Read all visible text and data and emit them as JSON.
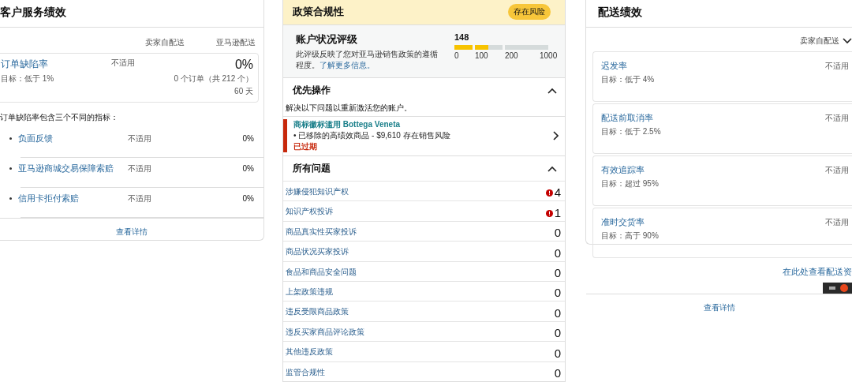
{
  "customer_service": {
    "title": "客户服务绩效",
    "columns": [
      "卖家自配送",
      "亚马逊配送"
    ],
    "metric": {
      "name": "订单缺陷率",
      "target": "目标：低于 1%",
      "mfn": "不适用",
      "afn": "0%",
      "orders": "0 个订单（共 212 个）",
      "period": "60 天"
    },
    "intro": "订单缺陷率包含三个不同的指标：",
    "sub_metrics": [
      {
        "name": "负面反馈",
        "mfn": "不适用",
        "afn": "0%"
      },
      {
        "name": "亚马逊商城交易保障索赔",
        "mfn": "不适用",
        "afn": "0%"
      },
      {
        "name": "信用卡拒付索赔",
        "mfn": "不适用",
        "afn": "0%"
      }
    ],
    "details_link": "查看详情"
  },
  "policy": {
    "title": "政策合规性",
    "badge": "存在风险",
    "rating": {
      "title": "账户状况评级",
      "description": "此评级反映了您对亚马逊销售政策的遵循程度。",
      "link": "了解更多信息。",
      "score": "148",
      "segments": [
        {
          "level": 1
        },
        {
          "level": 0.48
        },
        {
          "level": 0
        }
      ],
      "ticks": [
        "0",
        "100",
        "200",
        "1000"
      ]
    },
    "priority": {
      "title": "优先操作",
      "expanded": true,
      "hint": "解决以下问题以重新激活您的账户。",
      "items": [
        {
          "title": "商标徽标滥用 Bottega Veneta",
          "detail": "• 已移除的高绩效商品 - $9,610 存在销售风险",
          "status": "已过期"
        }
      ]
    },
    "issues": {
      "title": "所有问题",
      "expanded": true,
      "rows": [
        {
          "name": "涉嫌侵犯知识产权",
          "count": "4",
          "alert": true
        },
        {
          "name": "知识产权投诉",
          "count": "1",
          "alert": true
        },
        {
          "name": "商品真实性买家投诉",
          "count": "0",
          "alert": false
        },
        {
          "name": "商品状况买家投诉",
          "count": "0",
          "alert": false
        },
        {
          "name": "食品和商品安全问题",
          "count": "0",
          "alert": false
        },
        {
          "name": "上架政策违规",
          "count": "0",
          "alert": false
        },
        {
          "name": "违反受限商品政策",
          "count": "0",
          "alert": false
        },
        {
          "name": "违反买家商品评论政策",
          "count": "0",
          "alert": false
        },
        {
          "name": "其他违反政策",
          "count": "0",
          "alert": false
        },
        {
          "name": "监管合规性",
          "count": "0",
          "alert": false
        }
      ]
    }
  },
  "shipping": {
    "title": "配送绩效",
    "filter": "卖家自配送",
    "metrics": [
      {
        "name": "迟发率",
        "target": "目标：低于 4%",
        "value": "不适用"
      },
      {
        "name": "配送前取消率",
        "target": "目标：低于 2.5%",
        "value": "不适用"
      },
      {
        "name": "有效追踪率",
        "target": "目标：超过 95%",
        "value": "不适用"
      },
      {
        "name": "准时交货率",
        "target": "目标：高于 90%",
        "value": "不适用"
      }
    ],
    "link": "在此处查看配送资",
    "details_link": "查看详情"
  }
}
